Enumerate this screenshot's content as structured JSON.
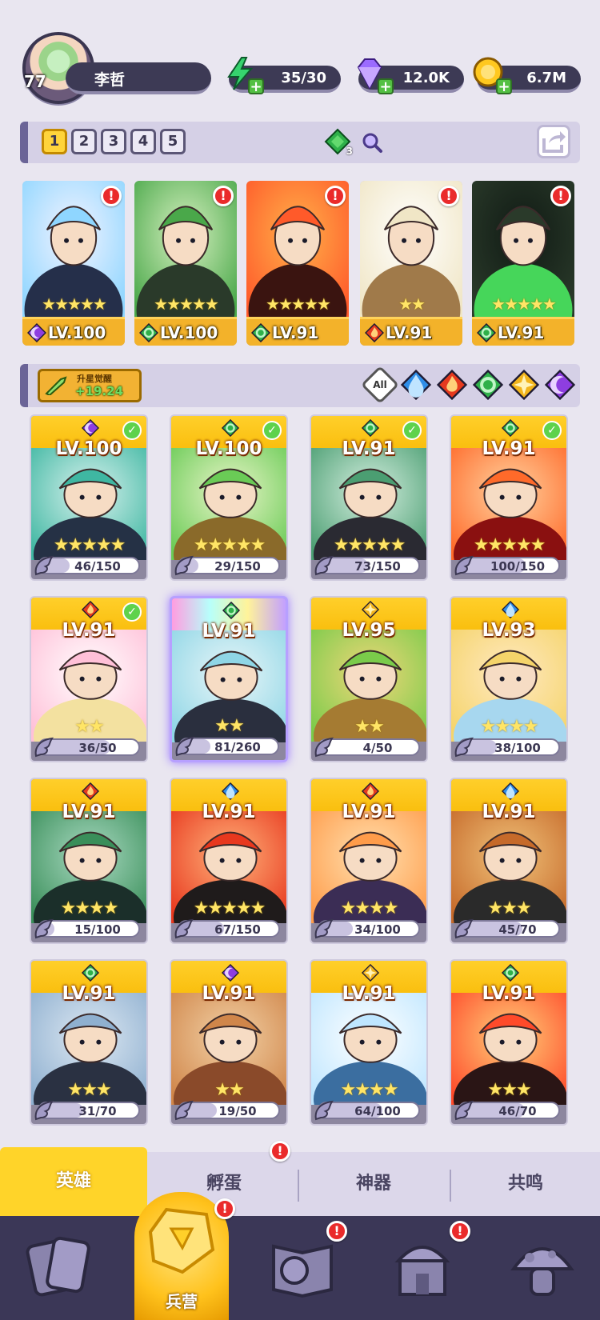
{
  "player": {
    "level": "77",
    "name": "李哲"
  },
  "resources": {
    "energy": {
      "icon": "lightning-icon",
      "value": "35/30"
    },
    "gems": {
      "icon": "diamond-icon",
      "value": "12.0K"
    },
    "gold": {
      "icon": "coin-icon",
      "value": "6.7M"
    }
  },
  "team_bar": {
    "slots": [
      "1",
      "2",
      "3",
      "4",
      "5"
    ],
    "active_slot": "1",
    "gem_badge": "3"
  },
  "team": [
    {
      "level": "LV.100",
      "element": "dark",
      "stars": "★★★★★"
    },
    {
      "level": "LV.100",
      "element": "nature",
      "stars": "★★★★★"
    },
    {
      "level": "LV.91",
      "element": "nature",
      "stars": "★★★★★"
    },
    {
      "level": "LV.91",
      "element": "fire",
      "stars": "★★"
    },
    {
      "level": "LV.91",
      "element": "nature",
      "stars": "★★★★★"
    }
  ],
  "filter_bar": {
    "awaken_label": "升星觉醒",
    "awaken_value": "+19.24",
    "all_label": "All",
    "elements": [
      "water",
      "fire",
      "nature",
      "light",
      "dark"
    ]
  },
  "heroes": [
    {
      "level": "LV.100",
      "element": "dark",
      "checked": true,
      "stars": "★★★★★",
      "progress": "46/150",
      "ratio": 0.31
    },
    {
      "level": "LV.100",
      "element": "nature",
      "checked": true,
      "stars": "★★★★★",
      "progress": "29/150",
      "ratio": 0.19
    },
    {
      "level": "LV.91",
      "element": "nature",
      "checked": true,
      "stars": "★★★★★",
      "progress": "73/150",
      "ratio": 0.49
    },
    {
      "level": "LV.91",
      "element": "nature",
      "checked": true,
      "stars": "★★★★★",
      "progress": "100/150",
      "ratio": 0.67
    },
    {
      "level": "LV.91",
      "element": "fire",
      "checked": true,
      "stars": "★★",
      "progress": "36/50",
      "ratio": 0.72
    },
    {
      "level": "LV.91",
      "element": "nature",
      "checked": false,
      "stars": "★★",
      "progress": "81/260",
      "ratio": 0.31,
      "special": true
    },
    {
      "level": "LV.95",
      "element": "light",
      "checked": false,
      "stars": "★★",
      "progress": "4/50",
      "ratio": 0.08
    },
    {
      "level": "LV.93",
      "element": "water",
      "checked": false,
      "stars": "★★★★",
      "progress": "38/100",
      "ratio": 0.38
    },
    {
      "level": "LV.91",
      "element": "fire",
      "checked": false,
      "stars": "★★★★",
      "progress": "15/100",
      "ratio": 0.15
    },
    {
      "level": "LV.91",
      "element": "water",
      "checked": false,
      "stars": "★★★★★",
      "progress": "67/150",
      "ratio": 0.45
    },
    {
      "level": "LV.91",
      "element": "fire",
      "checked": false,
      "stars": "★★★★",
      "progress": "34/100",
      "ratio": 0.34
    },
    {
      "level": "LV.91",
      "element": "water",
      "checked": false,
      "stars": "★★★",
      "progress": "45/70",
      "ratio": 0.64
    },
    {
      "level": "LV.91",
      "element": "nature",
      "checked": false,
      "stars": "★★★",
      "progress": "31/70",
      "ratio": 0.44
    },
    {
      "level": "LV.91",
      "element": "dark",
      "checked": false,
      "stars": "★★",
      "progress": "19/50",
      "ratio": 0.38
    },
    {
      "level": "LV.91",
      "element": "light",
      "checked": false,
      "stars": "★★★★",
      "progress": "64/100",
      "ratio": 0.64
    },
    {
      "level": "LV.91",
      "element": "nature",
      "checked": false,
      "stars": "★★★",
      "progress": "46/70",
      "ratio": 0.66
    }
  ],
  "tabs": [
    "英雄",
    "孵蛋",
    "神器",
    "共鸣"
  ],
  "nav": {
    "active_label": "兵营"
  },
  "colors": {
    "gold": "#ffd429",
    "panel": "#d5d0e6",
    "nav": "#3b3757",
    "alert": "#ea2b2b",
    "water": "#2f8ee8",
    "fire": "#e63a1e",
    "nature": "#2fb04a",
    "light": "#f2b51c",
    "dark": "#8e3ee0"
  }
}
